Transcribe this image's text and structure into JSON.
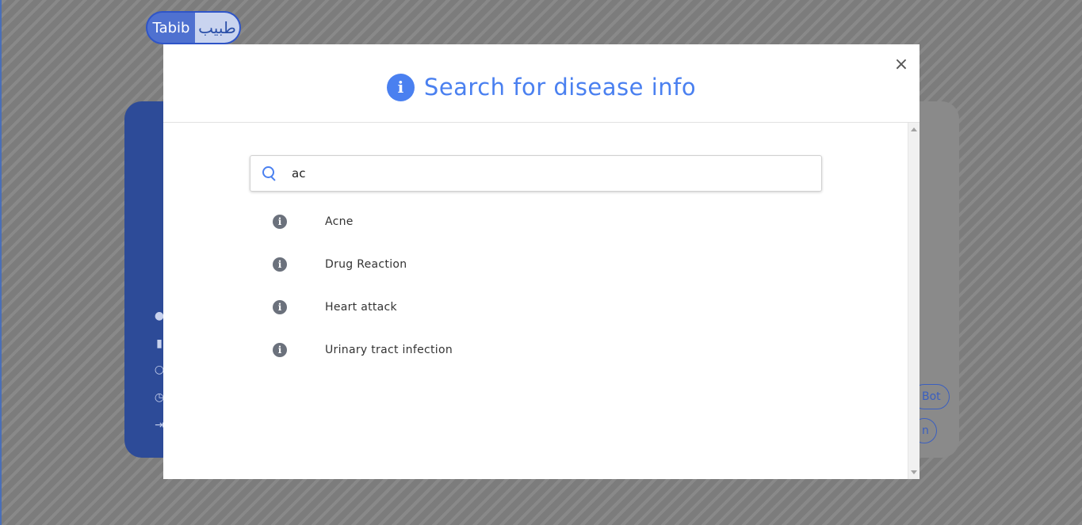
{
  "logo": {
    "text_en": "Tabib",
    "text_ar": "طبيب"
  },
  "background": {
    "pill_bot_label": "Bot",
    "pill_second_label": "n"
  },
  "modal": {
    "title": "Search for disease info",
    "close_symbol": "×",
    "search": {
      "value": "ac",
      "placeholder": ""
    },
    "results": [
      {
        "label": "Acne"
      },
      {
        "label": "Drug Reaction"
      },
      {
        "label": "Heart attack"
      },
      {
        "label": "Urinary tract infection"
      }
    ]
  },
  "colors": {
    "accent": "#4a80f0",
    "overlay": "#7c7c7c",
    "info_icon": "#6b717c",
    "brand_dark": "#2d4b98"
  },
  "icons": {
    "title": "info-icon",
    "search": "search-icon",
    "result": "info-circle-icon",
    "close": "close-icon"
  }
}
